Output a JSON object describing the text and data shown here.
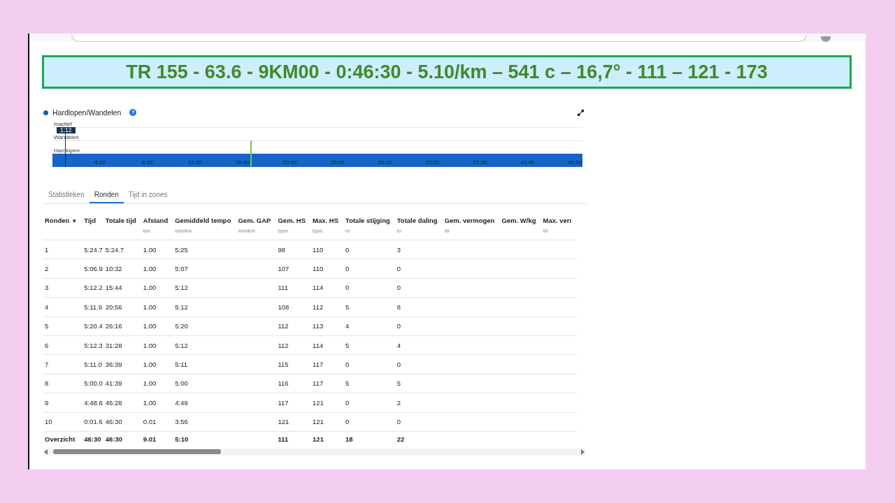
{
  "banner": {
    "text": "TR 155 - 63.6 - 9KM00 - 0:46:30 - 5.10/km – 541 c – 16,7° - 111 – 121 - 173"
  },
  "activity_chart": {
    "legend": "Hardlopen/Wandelen",
    "help": "?",
    "rows": [
      "Inactief",
      "Wandelen",
      "Hardlopen"
    ],
    "marker": "1:12",
    "time_labels": [
      "4:10",
      "8:20",
      "12:30",
      "16:40",
      "20:50",
      "25:00",
      "29:10",
      "33:20",
      "37:30",
      "41:40",
      "45:50"
    ]
  },
  "tabs": [
    {
      "label": "Statistieken",
      "selected": false
    },
    {
      "label": "Ronden",
      "selected": true
    },
    {
      "label": "Tijd in zones",
      "selected": false
    }
  ],
  "table": {
    "columns": [
      {
        "label": "Ronden",
        "sort_icon": "▼"
      },
      {
        "label": "Tijd"
      },
      {
        "label": "Totale tijd"
      },
      {
        "label": "Afstand",
        "unit": "km"
      },
      {
        "label": "Gemiddeld tempo",
        "unit": "min/km"
      },
      {
        "label": "Gem. GAP",
        "unit": "min/km"
      },
      {
        "label": "Gem. HS",
        "unit": "bpm"
      },
      {
        "label": "Max. HS",
        "unit": "bpm"
      },
      {
        "label": "Totale stijging",
        "unit": "m"
      },
      {
        "label": "Totale daling",
        "unit": "m"
      },
      {
        "label": "Gem. vermogen",
        "unit": "W"
      },
      {
        "label": "Gem. W/kg"
      },
      {
        "label": "Max. verı",
        "unit": "W"
      }
    ],
    "rows": [
      [
        "1",
        "5:24.7",
        "5:24.7",
        "1.00",
        "5:25",
        "",
        "98",
        "110",
        "0",
        "3"
      ],
      [
        "2",
        "5:06.9",
        "10:32",
        "1.00",
        "5:07",
        "",
        "107",
        "110",
        "0",
        "0"
      ],
      [
        "3",
        "5:12.2",
        "15:44",
        "1.00",
        "5:12",
        "",
        "111",
        "114",
        "0",
        "0"
      ],
      [
        "4",
        "5:11.9",
        "20:56",
        "1.00",
        "5:12",
        "",
        "108",
        "112",
        "5",
        "8"
      ],
      [
        "5",
        "5:20.4",
        "26:16",
        "1.00",
        "5:20",
        "",
        "112",
        "113",
        "4",
        "0"
      ],
      [
        "6",
        "5:12.3",
        "31:28",
        "1.00",
        "5:12",
        "",
        "112",
        "114",
        "5",
        "4"
      ],
      [
        "7",
        "5:11.0",
        "36:39",
        "1.00",
        "5:11",
        "",
        "115",
        "117",
        "0",
        "0"
      ],
      [
        "8",
        "5:00.0",
        "41:39",
        "1.00",
        "5:00",
        "",
        "116",
        "117",
        "5",
        "5"
      ],
      [
        "9",
        "4:48.8",
        "46:28",
        "1.00",
        "4:49",
        "",
        "117",
        "121",
        "0",
        "2"
      ],
      [
        "10",
        "0:01.6",
        "46:30",
        "0.01",
        "3:56",
        "",
        "121",
        "121",
        "0",
        "0"
      ]
    ],
    "summary": [
      "Overzicht",
      "46:30",
      "46:30",
      "9.01",
      {
        "text": "5:10",
        "colspan": 2
      },
      "111",
      "121",
      "18",
      "22"
    ]
  }
}
